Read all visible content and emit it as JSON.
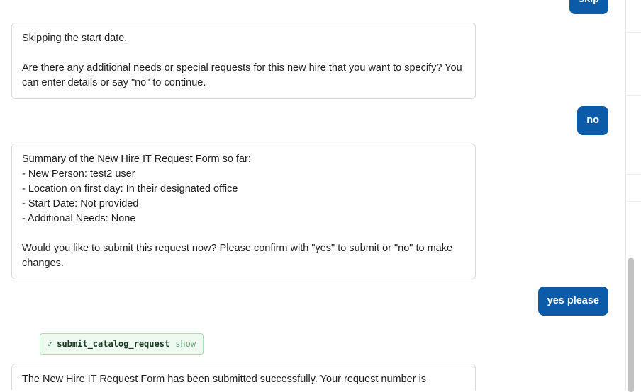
{
  "messages": [
    {
      "role": "user",
      "text": "skip"
    },
    {
      "role": "assistant",
      "text": "Skipping the start date.\n\nAre there any additional needs or special requests for this new hire that you want to specify? You can enter details or say \"no\" to continue."
    },
    {
      "role": "user",
      "text": "no"
    },
    {
      "role": "assistant",
      "text": "Summary of the New Hire IT Request Form so far:\n- New Person: test2 user\n- Location on first day: In their designated office\n- Start Date: Not provided\n- Additional Needs: None\n\nWould you like to submit this request now? Please confirm with \"yes\" to submit or \"no\" to make changes."
    },
    {
      "role": "user",
      "text": "yes please"
    },
    {
      "role": "tool",
      "check": "✓",
      "name": "submit_catalog_request",
      "action": "show"
    },
    {
      "role": "assistant",
      "text": "The New Hire IT Request Form has been submitted successfully. Your request number is"
    }
  ],
  "colors": {
    "user_bubble": "#0b5ba8",
    "tool_bg": "#eefaf0",
    "tool_border": "#a6dbb0",
    "bot_border": "#d9d9d9"
  }
}
